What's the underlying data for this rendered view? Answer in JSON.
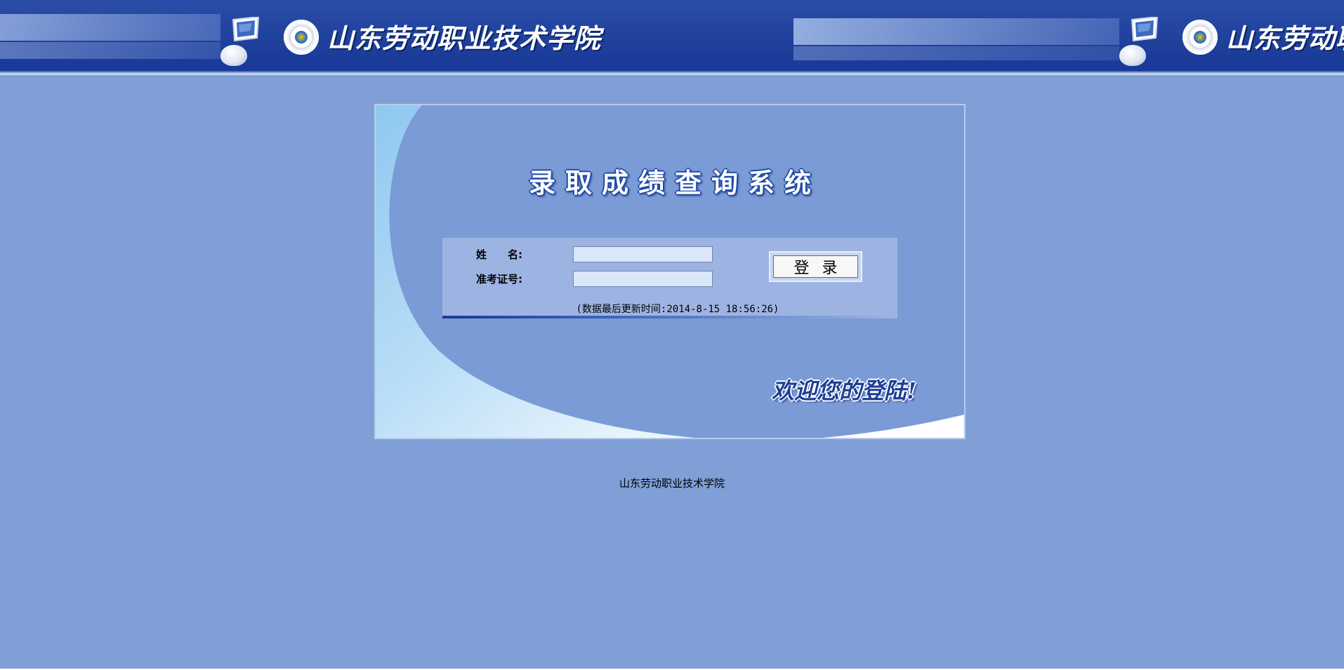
{
  "header": {
    "school_name": "山东劳动职业技术学院"
  },
  "login": {
    "system_title": "录取成绩查询系统",
    "name_label": "姓　　名:",
    "exam_id_label": "准考证号:",
    "name_value": "",
    "exam_id_value": "",
    "login_button_label": "登录",
    "update_notice": "(数据最后更新时间:2014-8-15 18:56:26)",
    "welcome": "欢迎您的登陆!"
  },
  "footer": {
    "school_name": "山东劳动职业技术学院"
  },
  "colors": {
    "page_background": "#7f9fd6",
    "banner": "#1e3f9a",
    "panel": "#7a9bd6",
    "form_box": "#9db4e2",
    "input_background": "#dbe8fb"
  }
}
